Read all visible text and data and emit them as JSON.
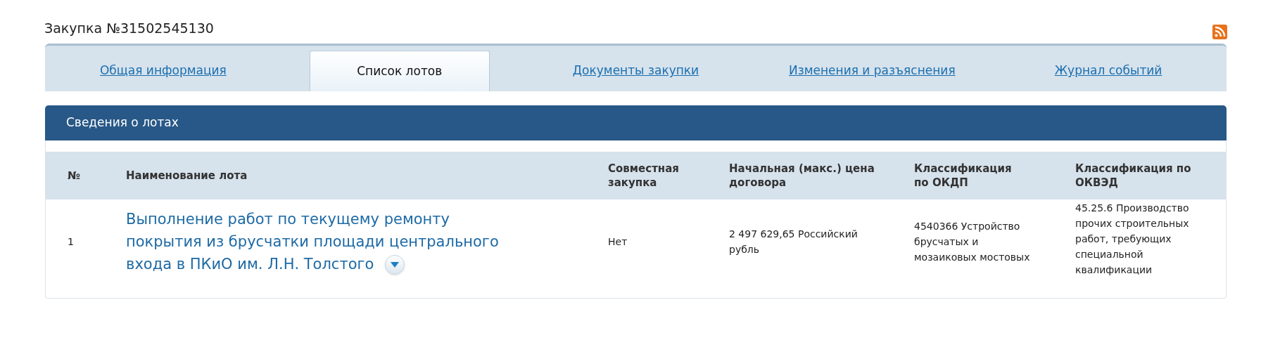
{
  "page_title": "Закупка №31502545130",
  "tabs": [
    {
      "label": "Общая информация",
      "selected": false
    },
    {
      "label": "Список лотов",
      "selected": true
    },
    {
      "label": "Документы закупки",
      "selected": false
    },
    {
      "label": "Изменения и разъяснения",
      "selected": false
    },
    {
      "label": "Журнал событий",
      "selected": false
    }
  ],
  "section_title": "Сведения о лотах",
  "table": {
    "columns": [
      "№",
      "Наименование лота",
      "Совместная закупка",
      "Начальная (макс.) цена договора",
      "Классификация по ОКДП",
      "Классификация по ОКВЭД"
    ],
    "rows": [
      {
        "number": "1",
        "name": "Выполнение работ по текущему ремонту покрытия из брусчатки площади центрального входа в ПКиО им. Л.Н. Толстого",
        "joint": "Нет",
        "price": "2 497 629,65 Российский рубль",
        "okdp": "4540366 Устройство брусчатых и мозаиковых мостовых",
        "okved": "45.25.6 Производство прочих строительных работ, требующих специальной квалификации",
        "expanded": false
      }
    ]
  }
}
